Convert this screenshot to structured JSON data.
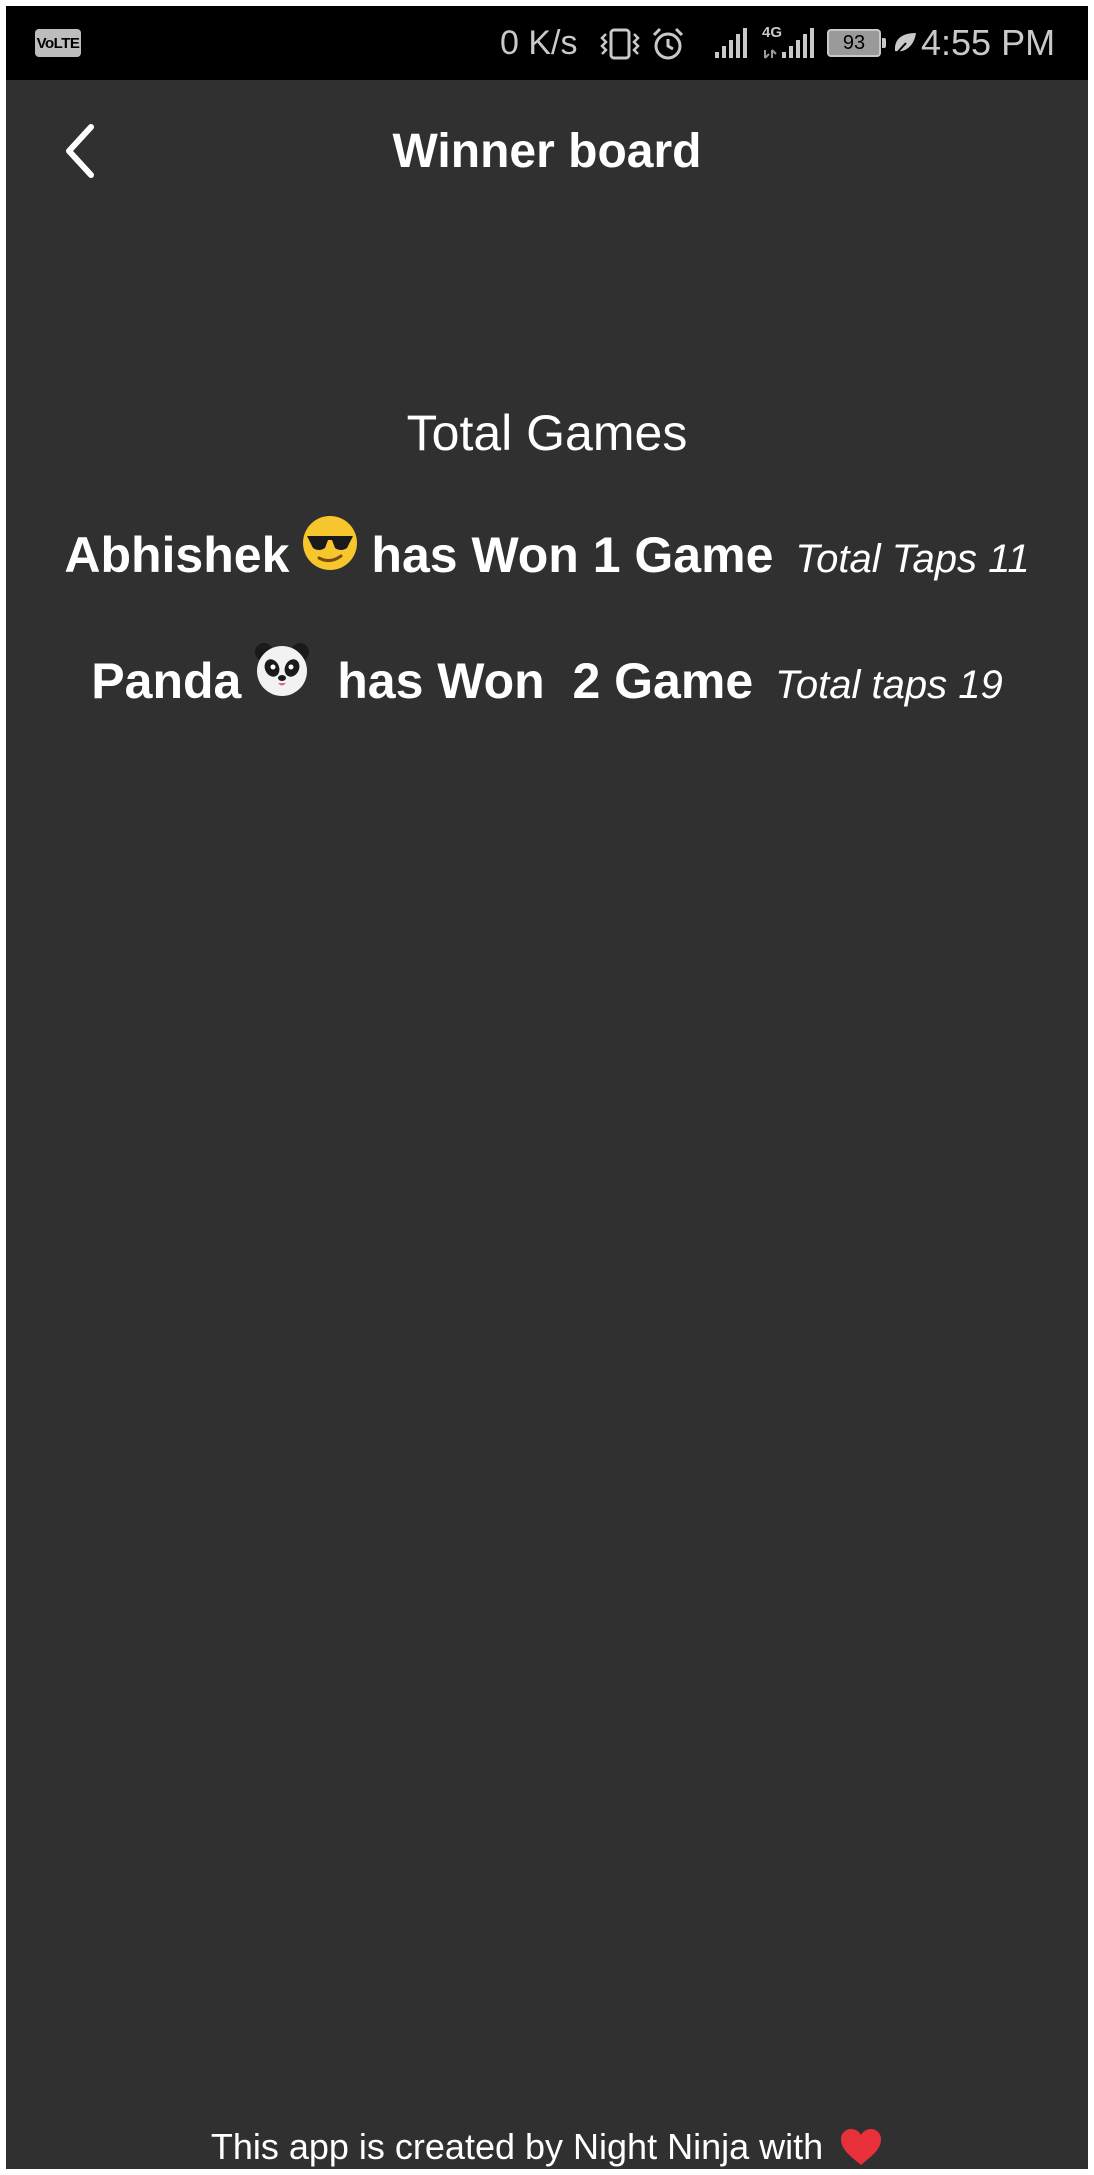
{
  "status_bar": {
    "volte": "VoLTE",
    "net_speed": "0 K/s",
    "network_type": "4G",
    "battery_level": "93",
    "time": "4:55 PM"
  },
  "app_bar": {
    "title": "Winner board",
    "back_icon": "chevron-left-icon"
  },
  "main": {
    "section_title": "Total Games",
    "winners": [
      {
        "name": "Abhishek",
        "emoji_icon": "sunglasses-face-icon",
        "result": "has Won 1 Game",
        "taps": "Total Taps 11"
      },
      {
        "name": "Panda",
        "emoji_icon": "panda-face-icon",
        "result": " has Won  2 Game",
        "taps": "Total taps 19"
      }
    ]
  },
  "footer": {
    "text": "This app is created by Night Ninja with",
    "heart_icon": "red-heart-icon",
    "heart_color": "#e8303a"
  },
  "colors": {
    "background": "#303030",
    "status_bar": "#000000",
    "text": "#ffffff"
  }
}
